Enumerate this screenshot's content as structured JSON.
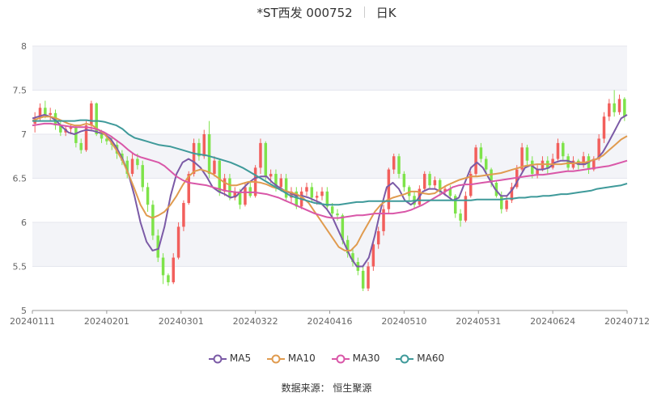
{
  "title": {
    "name": "*ST西发 000752",
    "period": "日K"
  },
  "source": "数据来源： 恒生聚源",
  "chart_data": {
    "type": "candlestick",
    "x_tick_labels": [
      "20240111",
      "20240201",
      "20240301",
      "20240322",
      "20240416",
      "20240510",
      "20240531",
      "20240624",
      "20240712"
    ],
    "y_ticks": [
      5,
      5.5,
      6,
      6.5,
      7,
      7.5,
      8
    ],
    "ylim": [
      5,
      8
    ],
    "grid": true,
    "legend_position": "bottom",
    "colors": {
      "up": "#f25f5c",
      "down": "#7ee34a",
      "ma5": "#7b5aa6",
      "ma10": "#e09b4f",
      "ma30": "#d957a8",
      "ma60": "#3f9a9a"
    },
    "candles": [
      [
        7.12,
        7.18,
        7.02,
        7.25
      ],
      [
        7.18,
        7.3,
        7.15,
        7.35
      ],
      [
        7.3,
        7.22,
        7.18,
        7.38
      ],
      [
        7.22,
        7.24,
        7.15,
        7.3
      ],
      [
        7.24,
        7.1,
        7.05,
        7.28
      ],
      [
        7.1,
        7.02,
        6.98,
        7.15
      ],
      [
        7.02,
        7.06,
        6.98,
        7.1
      ],
      [
        7.06,
        7.08,
        7.0,
        7.12
      ],
      [
        7.08,
        6.9,
        6.85,
        7.1
      ],
      [
        6.9,
        6.82,
        6.78,
        6.95
      ],
      [
        6.82,
        7.1,
        6.8,
        7.15
      ],
      [
        7.1,
        7.35,
        7.05,
        7.38
      ],
      [
        7.35,
        7.0,
        6.98,
        7.36
      ],
      [
        7.0,
        6.95,
        6.9,
        7.05
      ],
      [
        6.95,
        6.92,
        6.88,
        7.0
      ],
      [
        6.92,
        6.88,
        6.82,
        6.98
      ],
      [
        6.88,
        6.78,
        6.72,
        6.92
      ],
      [
        6.78,
        6.7,
        6.65,
        6.82
      ],
      [
        6.7,
        6.55,
        6.5,
        6.75
      ],
      [
        6.55,
        6.72,
        6.52,
        6.78
      ],
      [
        6.72,
        6.65,
        6.6,
        6.78
      ],
      [
        6.65,
        6.4,
        6.35,
        6.7
      ],
      [
        6.4,
        6.2,
        6.12,
        6.45
      ],
      [
        6.2,
        5.85,
        5.8,
        6.25
      ],
      [
        5.85,
        5.6,
        5.55,
        5.92
      ],
      [
        5.6,
        5.4,
        5.3,
        5.65
      ],
      [
        5.4,
        5.32,
        5.28,
        5.42
      ],
      [
        5.32,
        5.6,
        5.3,
        5.65
      ],
      [
        5.6,
        5.95,
        5.58,
        6.0
      ],
      [
        5.95,
        6.22,
        5.9,
        6.25
      ],
      [
        6.22,
        6.55,
        6.2,
        6.58
      ],
      [
        6.55,
        6.9,
        6.52,
        6.95
      ],
      [
        6.9,
        6.75,
        6.7,
        6.95
      ],
      [
        6.75,
        7.0,
        6.72,
        7.05
      ],
      [
        7.0,
        6.55,
        6.5,
        7.15
      ],
      [
        6.55,
        6.7,
        6.52,
        6.75
      ],
      [
        6.7,
        6.35,
        6.3,
        6.72
      ],
      [
        6.35,
        6.5,
        6.3,
        6.55
      ],
      [
        6.5,
        6.28,
        6.25,
        6.55
      ],
      [
        6.28,
        6.35,
        6.25,
        6.4
      ],
      [
        6.35,
        6.2,
        6.15,
        6.38
      ],
      [
        6.2,
        6.4,
        6.18,
        6.45
      ],
      [
        6.4,
        6.3,
        6.28,
        6.45
      ],
      [
        6.3,
        6.62,
        6.28,
        6.65
      ],
      [
        6.62,
        6.9,
        6.55,
        6.95
      ],
      [
        6.9,
        6.52,
        6.48,
        6.92
      ],
      [
        6.52,
        6.55,
        6.45,
        6.6
      ],
      [
        6.55,
        6.4,
        6.35,
        6.6
      ],
      [
        6.4,
        6.5,
        6.35,
        6.55
      ],
      [
        6.5,
        6.28,
        6.25,
        6.55
      ],
      [
        6.28,
        6.35,
        6.22,
        6.4
      ],
      [
        6.35,
        6.18,
        6.15,
        6.4
      ],
      [
        6.18,
        6.35,
        6.15,
        6.4
      ],
      [
        6.35,
        6.4,
        6.3,
        6.45
      ],
      [
        6.4,
        6.28,
        6.22,
        6.45
      ],
      [
        6.28,
        6.3,
        6.2,
        6.35
      ],
      [
        6.3,
        6.35,
        6.25,
        6.4
      ],
      [
        6.35,
        6.18,
        6.15,
        6.4
      ],
      [
        6.18,
        6.1,
        6.05,
        6.22
      ],
      [
        6.1,
        6.08,
        6.02,
        6.15
      ],
      [
        6.08,
        5.8,
        5.75,
        6.1
      ],
      [
        5.8,
        5.65,
        5.6,
        5.85
      ],
      [
        5.65,
        5.55,
        5.5,
        5.7
      ],
      [
        5.55,
        5.45,
        5.4,
        5.6
      ],
      [
        5.45,
        5.25,
        5.22,
        5.5
      ],
      [
        5.25,
        5.5,
        5.22,
        5.55
      ],
      [
        5.5,
        5.75,
        5.45,
        5.8
      ],
      [
        5.75,
        5.9,
        5.7,
        5.95
      ],
      [
        5.9,
        6.15,
        5.85,
        6.2
      ],
      [
        6.15,
        6.6,
        6.1,
        6.62
      ],
      [
        6.6,
        6.75,
        6.55,
        6.78
      ],
      [
        6.75,
        6.55,
        6.5,
        6.78
      ],
      [
        6.55,
        6.4,
        6.35,
        6.58
      ],
      [
        6.4,
        6.3,
        6.25,
        6.42
      ],
      [
        6.3,
        6.2,
        6.15,
        6.35
      ],
      [
        6.2,
        6.38,
        6.18,
        6.42
      ],
      [
        6.38,
        6.55,
        6.35,
        6.58
      ],
      [
        6.55,
        6.42,
        6.38,
        6.58
      ],
      [
        6.42,
        6.48,
        6.38,
        6.52
      ],
      [
        6.48,
        6.35,
        6.3,
        6.5
      ],
      [
        6.35,
        6.38,
        6.3,
        6.42
      ],
      [
        6.38,
        6.3,
        6.28,
        6.42
      ],
      [
        6.3,
        6.1,
        6.05,
        6.32
      ],
      [
        6.1,
        6.02,
        5.95,
        6.15
      ],
      [
        6.02,
        6.3,
        6.0,
        6.35
      ],
      [
        6.3,
        6.55,
        6.28,
        6.58
      ],
      [
        6.55,
        6.85,
        6.52,
        6.88
      ],
      [
        6.85,
        6.72,
        6.68,
        6.9
      ],
      [
        6.72,
        6.6,
        6.55,
        6.75
      ],
      [
        6.6,
        6.45,
        6.4,
        6.62
      ],
      [
        6.45,
        6.3,
        6.28,
        6.48
      ],
      [
        6.3,
        6.15,
        6.1,
        6.35
      ],
      [
        6.15,
        6.25,
        6.12,
        6.3
      ],
      [
        6.25,
        6.4,
        6.22,
        6.45
      ],
      [
        6.4,
        6.6,
        6.38,
        6.65
      ],
      [
        6.6,
        6.85,
        6.58,
        6.9
      ],
      [
        6.85,
        6.7,
        6.65,
        6.88
      ],
      [
        6.7,
        6.55,
        6.5,
        6.75
      ],
      [
        6.55,
        6.6,
        6.5,
        6.65
      ],
      [
        6.6,
        6.7,
        6.58,
        6.75
      ],
      [
        6.7,
        6.62,
        6.55,
        6.75
      ],
      [
        6.62,
        6.72,
        6.6,
        6.78
      ],
      [
        6.72,
        6.9,
        6.7,
        6.95
      ],
      [
        6.9,
        6.75,
        6.7,
        6.92
      ],
      [
        6.75,
        6.62,
        6.58,
        6.78
      ],
      [
        6.62,
        6.7,
        6.6,
        6.75
      ],
      [
        6.7,
        6.65,
        6.6,
        6.72
      ],
      [
        6.65,
        6.75,
        6.62,
        6.8
      ],
      [
        6.75,
        6.6,
        6.55,
        6.78
      ],
      [
        6.6,
        6.72,
        6.58,
        6.75
      ],
      [
        6.72,
        6.95,
        6.7,
        7.0
      ],
      [
        6.95,
        7.2,
        6.9,
        7.25
      ],
      [
        7.2,
        7.35,
        7.15,
        7.4
      ],
      [
        7.35,
        7.25,
        7.2,
        7.5
      ],
      [
        7.25,
        7.4,
        7.22,
        7.45
      ],
      [
        7.4,
        7.2,
        7.15,
        7.42
      ]
    ],
    "series": [
      {
        "name": "MA5",
        "values": [
          7.18,
          7.2,
          7.22,
          7.2,
          7.15,
          7.08,
          7.02,
          7.0,
          7.03,
          7.05,
          7.04,
          7.02,
          7.0,
          6.95,
          6.85,
          6.72,
          6.55,
          6.3,
          6.0,
          5.78,
          5.68,
          5.7,
          5.95,
          6.3,
          6.55,
          6.68,
          6.72,
          6.68,
          6.62,
          6.52,
          6.4,
          6.35,
          6.32,
          6.28,
          6.3,
          6.38,
          6.45,
          6.5,
          6.52,
          6.52,
          6.45,
          6.4,
          6.36,
          6.33,
          6.3,
          6.3,
          6.28,
          6.25,
          6.22,
          6.15,
          6.05,
          5.9,
          5.75,
          5.6,
          5.5,
          5.5,
          5.6,
          5.85,
          6.15,
          6.4,
          6.45,
          6.38,
          6.25,
          6.2,
          6.25,
          6.35,
          6.38,
          6.38,
          6.35,
          6.3,
          6.25,
          6.28,
          6.45,
          6.62,
          6.68,
          6.62,
          6.5,
          6.38,
          6.3,
          6.3,
          6.38,
          6.5,
          6.62,
          6.65,
          6.6,
          6.6,
          6.62,
          6.68,
          6.7,
          6.7,
          6.68,
          6.66,
          6.66,
          6.7,
          6.72,
          6.8,
          6.92,
          7.05,
          7.18,
          7.22
        ]
      },
      {
        "name": "MA10",
        "values": [
          7.15,
          7.18,
          7.2,
          7.2,
          7.18,
          7.15,
          7.12,
          7.1,
          7.1,
          7.12,
          7.1,
          7.05,
          7.0,
          6.92,
          6.82,
          6.7,
          6.55,
          6.38,
          6.2,
          6.08,
          6.05,
          6.08,
          6.12,
          6.2,
          6.3,
          6.42,
          6.52,
          6.58,
          6.6,
          6.58,
          6.55,
          6.5,
          6.45,
          6.42,
          6.42,
          6.44,
          6.46,
          6.46,
          6.45,
          6.43,
          6.4,
          6.38,
          6.36,
          6.34,
          6.32,
          6.28,
          6.22,
          6.12,
          6.02,
          5.92,
          5.82,
          5.72,
          5.68,
          5.68,
          5.75,
          5.88,
          6.0,
          6.12,
          6.2,
          6.25,
          6.28,
          6.3,
          6.32,
          6.35,
          6.35,
          6.33,
          6.32,
          6.33,
          6.38,
          6.42,
          6.45,
          6.48,
          6.5,
          6.52,
          6.52,
          6.53,
          6.54,
          6.55,
          6.56,
          6.58,
          6.6,
          6.62,
          6.64,
          6.65,
          6.66,
          6.66,
          6.66,
          6.66,
          6.66,
          6.67,
          6.67,
          6.68,
          6.68,
          6.7,
          6.72,
          6.76,
          6.82,
          6.88,
          6.94,
          6.98
        ]
      },
      {
        "name": "MA30",
        "values": [
          7.1,
          7.11,
          7.12,
          7.12,
          7.11,
          7.1,
          7.09,
          7.08,
          7.08,
          7.08,
          7.07,
          7.05,
          7.02,
          6.98,
          6.93,
          6.88,
          6.82,
          6.77,
          6.74,
          6.72,
          6.7,
          6.68,
          6.64,
          6.58,
          6.52,
          6.48,
          6.45,
          6.44,
          6.43,
          6.42,
          6.4,
          6.38,
          6.36,
          6.35,
          6.34,
          6.34,
          6.34,
          6.34,
          6.33,
          6.32,
          6.3,
          6.28,
          6.25,
          6.22,
          6.19,
          6.16,
          6.13,
          6.1,
          6.08,
          6.06,
          6.05,
          6.05,
          6.06,
          6.07,
          6.08,
          6.08,
          6.09,
          6.1,
          6.1,
          6.1,
          6.1,
          6.11,
          6.12,
          6.14,
          6.17,
          6.2,
          6.24,
          6.28,
          6.32,
          6.36,
          6.4,
          6.42,
          6.43,
          6.43,
          6.44,
          6.45,
          6.46,
          6.47,
          6.48,
          6.49,
          6.5,
          6.51,
          6.52,
          6.53,
          6.54,
          6.54,
          6.55,
          6.56,
          6.57,
          6.58,
          6.58,
          6.59,
          6.6,
          6.61,
          6.62,
          6.63,
          6.64,
          6.66,
          6.68,
          6.7
        ]
      },
      {
        "name": "MA60",
        "values": [
          7.15,
          7.15,
          7.15,
          7.15,
          7.15,
          7.15,
          7.15,
          7.15,
          7.16,
          7.16,
          7.15,
          7.15,
          7.14,
          7.12,
          7.1,
          7.06,
          7.0,
          6.96,
          6.94,
          6.92,
          6.9,
          6.88,
          6.87,
          6.86,
          6.84,
          6.82,
          6.8,
          6.78,
          6.77,
          6.76,
          6.74,
          6.72,
          6.7,
          6.68,
          6.65,
          6.62,
          6.58,
          6.54,
          6.5,
          6.46,
          6.42,
          6.38,
          6.34,
          6.3,
          6.28,
          6.26,
          6.24,
          6.22,
          6.21,
          6.2,
          6.2,
          6.2,
          6.21,
          6.22,
          6.23,
          6.23,
          6.24,
          6.24,
          6.24,
          6.24,
          6.24,
          6.24,
          6.24,
          6.24,
          6.25,
          6.25,
          6.25,
          6.25,
          6.25,
          6.25,
          6.25,
          6.25,
          6.25,
          6.25,
          6.26,
          6.26,
          6.26,
          6.26,
          6.26,
          6.27,
          6.27,
          6.28,
          6.28,
          6.29,
          6.29,
          6.3,
          6.3,
          6.31,
          6.32,
          6.32,
          6.33,
          6.34,
          6.35,
          6.36,
          6.38,
          6.39,
          6.4,
          6.41,
          6.42,
          6.44
        ]
      }
    ]
  }
}
